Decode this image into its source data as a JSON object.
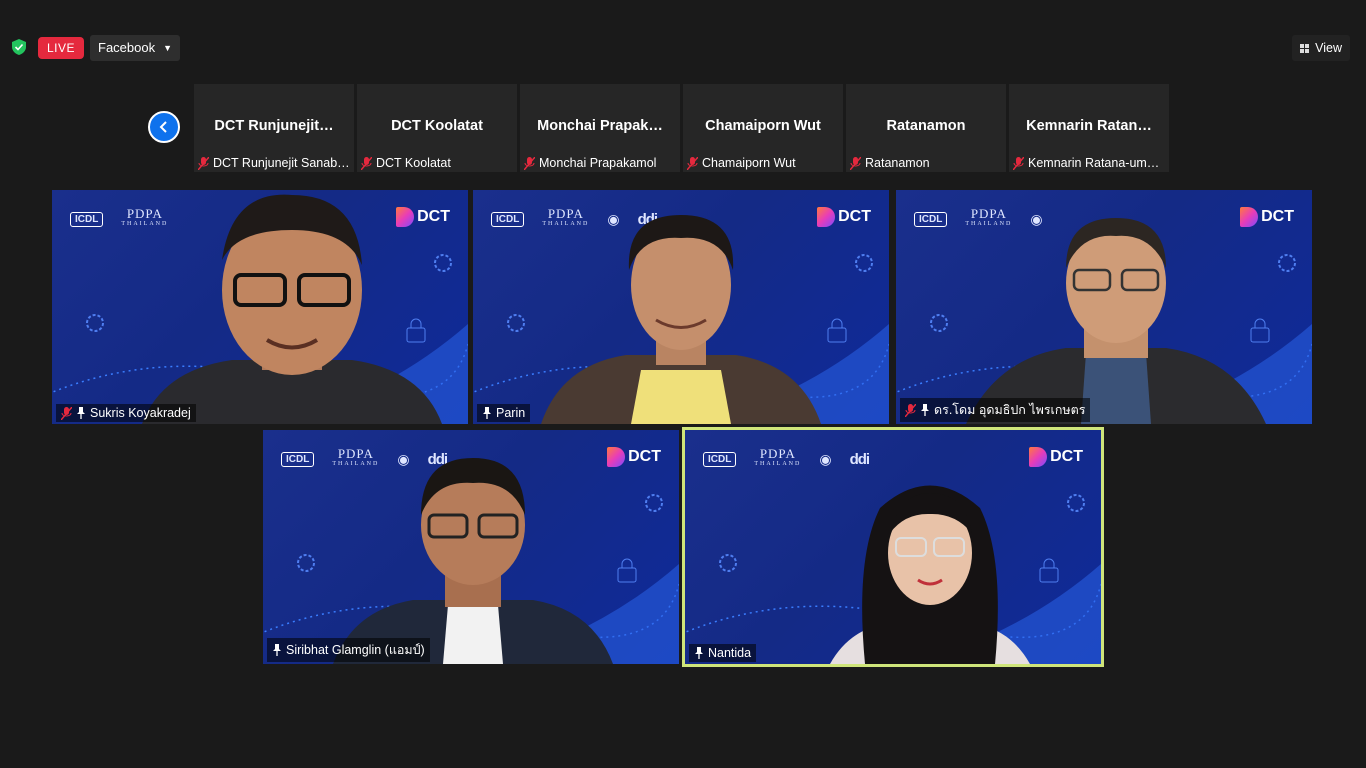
{
  "topbar": {
    "live_label": "LIVE",
    "stream_target": "Facebook",
    "view_label": "View"
  },
  "thumbnails": [
    {
      "name": "DCT  Runjunejit…",
      "footer": "DCT Runjunejit Sanab…"
    },
    {
      "name": "DCT Koolatat",
      "footer": "DCT Koolatat"
    },
    {
      "name": "Monchai  Prapak…",
      "footer": "Monchai Prapakamol"
    },
    {
      "name": "Chamaiporn Wut",
      "footer": "Chamaiporn Wut"
    },
    {
      "name": "Ratanamon",
      "footer": "Ratanamon"
    },
    {
      "name": "Kemnarin  Ratan…",
      "footer": "Kemnarin Ratana-um…"
    }
  ],
  "videos": [
    {
      "name": "Sukris Koyakradej",
      "muted": true
    },
    {
      "name": "Parin",
      "muted": false
    },
    {
      "name": "ดร.โดม  อุดมธิปก  ไพรเกษตร",
      "muted": true
    },
    {
      "name": "Siribhat Glamglin (แอมป์)",
      "muted": false
    },
    {
      "name": "Nantida",
      "muted": false,
      "active_speaker": true
    }
  ],
  "backdrop": {
    "logo_icdl": "ICDL",
    "logo_pdpa": "PDPA",
    "logo_pdpa_sub": "THAILAND",
    "logo_ddi": "ddi",
    "logo_dct": "DCT"
  },
  "colors": {
    "live_red": "#e5293e",
    "zoom_blue": "#0e72ed",
    "active_border": "#cfe57a",
    "mic_muted_red": "#e5293e"
  }
}
